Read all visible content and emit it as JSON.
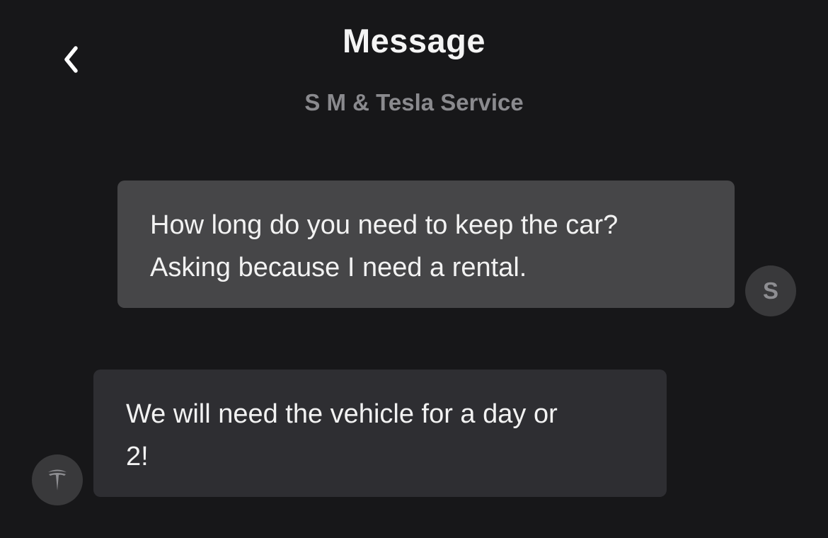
{
  "header": {
    "title": "Message",
    "subtitle": "S M & Tesla Service",
    "back_icon": "chevron-left-icon"
  },
  "messages": [
    {
      "direction": "outgoing",
      "text_line1": "How long do you need to keep the car?",
      "text_line2": "Asking because I need a rental.",
      "avatar_initial": "S"
    },
    {
      "direction": "incoming",
      "text_line1": "We will need the vehicle for a day or",
      "text_line2": "2!",
      "avatar_icon": "tesla-logo-icon"
    }
  ],
  "colors": {
    "background": "#171719",
    "outgoing_bubble": "#464648",
    "incoming_bubble": "#2e2e32",
    "avatar": "#39393b",
    "subtitle": "#8a8a8e"
  }
}
